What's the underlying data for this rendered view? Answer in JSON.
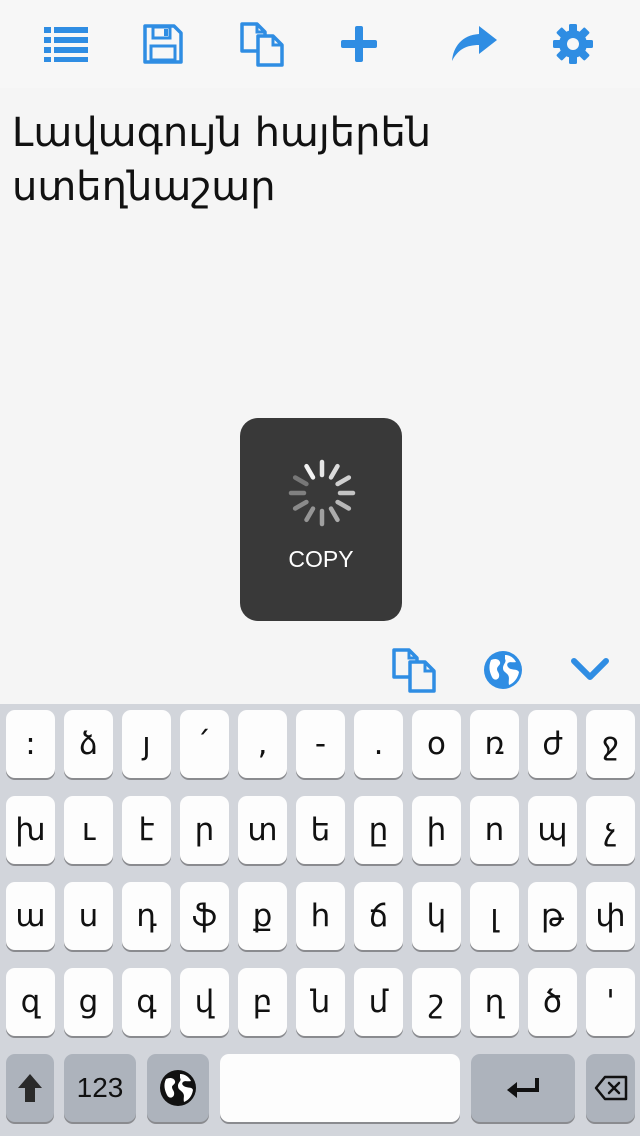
{
  "toolbar": {
    "buttons": [
      {
        "icon": "list-icon"
      },
      {
        "icon": "save-icon"
      },
      {
        "icon": "copy-icon"
      },
      {
        "icon": "plus-icon"
      },
      {
        "icon": "share-icon"
      },
      {
        "icon": "gear-icon"
      }
    ],
    "accent_color": "#2f8de3"
  },
  "editor": {
    "text": "Լավագույն հայերեն ստեղնաշար"
  },
  "hud": {
    "label": "COPY"
  },
  "accessory": {
    "buttons": [
      {
        "icon": "copy-icon"
      },
      {
        "icon": "globe-icon"
      },
      {
        "icon": "chevron-down-icon"
      }
    ]
  },
  "keyboard": {
    "row1": [
      ":",
      "ձ",
      "յ",
      "՛",
      ",",
      "-",
      ".",
      "օ",
      "ռ",
      "ժ",
      "ջ"
    ],
    "row2": [
      "խ",
      "ւ",
      "է",
      "ր",
      "տ",
      "ե",
      "ը",
      "ի",
      "ո",
      "պ",
      "չ"
    ],
    "row3": [
      "ա",
      "ս",
      "դ",
      "ֆ",
      "ք",
      "հ",
      "ճ",
      "կ",
      "լ",
      "թ",
      "փ"
    ],
    "row4": [
      "զ",
      "ց",
      "գ",
      "վ",
      "բ",
      "ն",
      "մ",
      "շ",
      "ղ",
      "ծ",
      "'"
    ],
    "numbers_label": "123",
    "bottom_icons": [
      "shift-icon",
      "globe-icon",
      "return-icon",
      "backspace-icon"
    ]
  }
}
